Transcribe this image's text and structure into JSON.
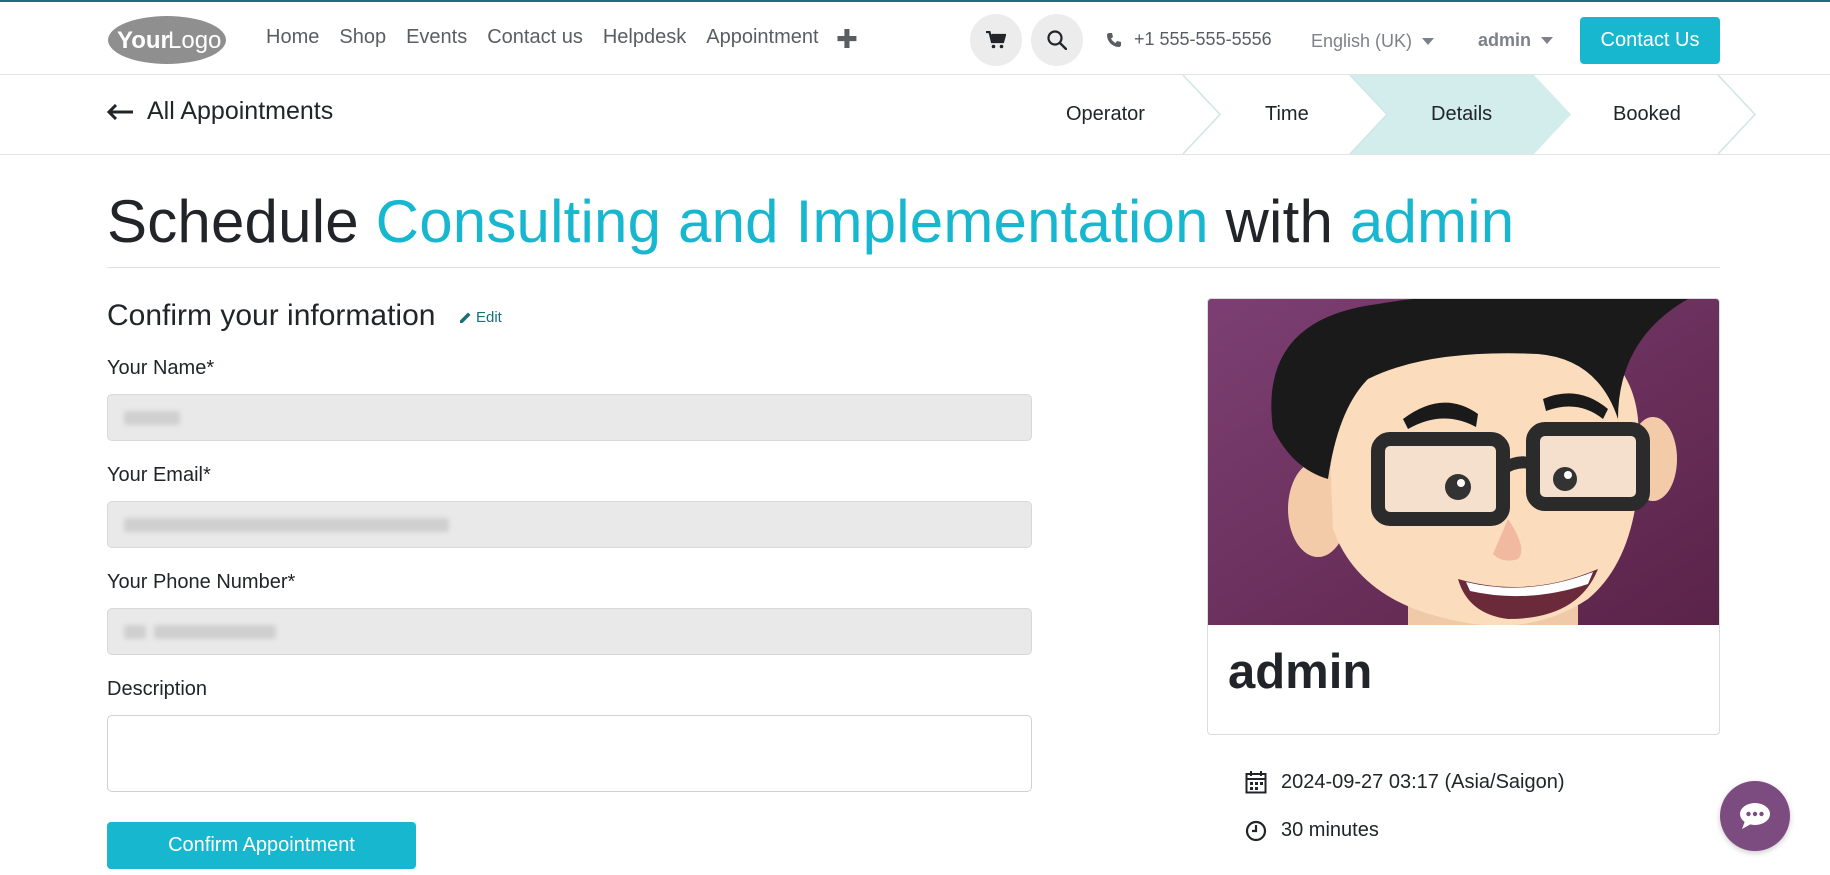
{
  "navbar": {
    "logo_text_your": "Your",
    "logo_text_logo": "Logo",
    "links": [
      "Home",
      "Shop",
      "Events",
      "Contact us",
      "Helpdesk",
      "Appointment"
    ],
    "plus_icon": "plus-icon",
    "cart_icon": "cart-icon",
    "search_icon": "search-icon",
    "phone": "+1 555-555-5556",
    "language": "English (UK)",
    "user": "admin",
    "contact_button": "Contact Us"
  },
  "subbar": {
    "back_label": "All Appointments",
    "steps": [
      "Operator",
      "Time",
      "Details",
      "Booked"
    ],
    "active_step": "Details"
  },
  "title": {
    "prefix": "Schedule",
    "service": "Consulting and Implementation",
    "with": "with",
    "operator": "admin"
  },
  "form": {
    "section_title": "Confirm your information",
    "edit_label": "Edit",
    "name_label": "Your Name*",
    "email_label": "Your Email*",
    "phone_label": "Your Phone Number*",
    "description_label": "Description",
    "confirm_button": "Confirm Appointment"
  },
  "card": {
    "name": "admin",
    "datetime": "2024-09-27 03:17 (Asia/Saigon)",
    "duration": "30 minutes"
  },
  "colors": {
    "accent": "#17b8cf",
    "active_step_bg": "#d3ecec",
    "chat": "#7c4b7f"
  }
}
